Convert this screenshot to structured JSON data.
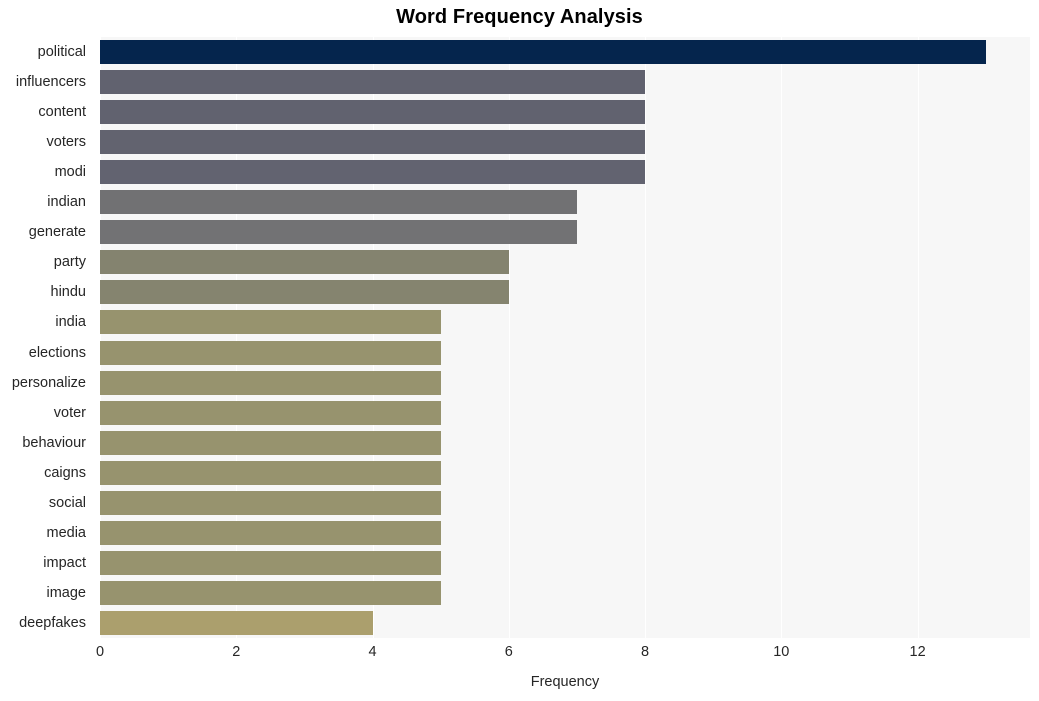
{
  "chart_data": {
    "type": "bar",
    "orientation": "horizontal",
    "title": "Word Frequency Analysis",
    "xlabel": "Frequency",
    "ylabel": "",
    "categories": [
      "political",
      "influencers",
      "content",
      "voters",
      "modi",
      "indian",
      "generate",
      "party",
      "hindu",
      "india",
      "elections",
      "personalize",
      "voter",
      "behaviour",
      "caigns",
      "social",
      "media",
      "impact",
      "image",
      "deepfakes"
    ],
    "values": [
      13,
      8,
      8,
      8,
      8,
      7,
      7,
      6,
      6,
      5,
      5,
      5,
      5,
      5,
      5,
      5,
      5,
      5,
      5,
      4
    ],
    "bar_colors": [
      "#05254d",
      "#61626f",
      "#61626f",
      "#62636f",
      "#626370",
      "#717173",
      "#727274",
      "#84836f",
      "#85846f",
      "#97936e",
      "#97936e",
      "#97936e",
      "#97936e",
      "#97936e",
      "#97936e",
      "#97936e",
      "#97936e",
      "#97936e",
      "#97936e",
      "#ab9f6d"
    ],
    "xticks": [
      0,
      2,
      4,
      6,
      8,
      10,
      12
    ],
    "xtick_labels": [
      "0",
      "2",
      "4",
      "6",
      "8",
      "10",
      "12"
    ],
    "xlim": [
      0,
      13.65
    ],
    "grid": true,
    "grid_color": "#ffffff",
    "plot_background": "#f7f7f7",
    "figure_background": "#ffffff",
    "legend": null
  }
}
